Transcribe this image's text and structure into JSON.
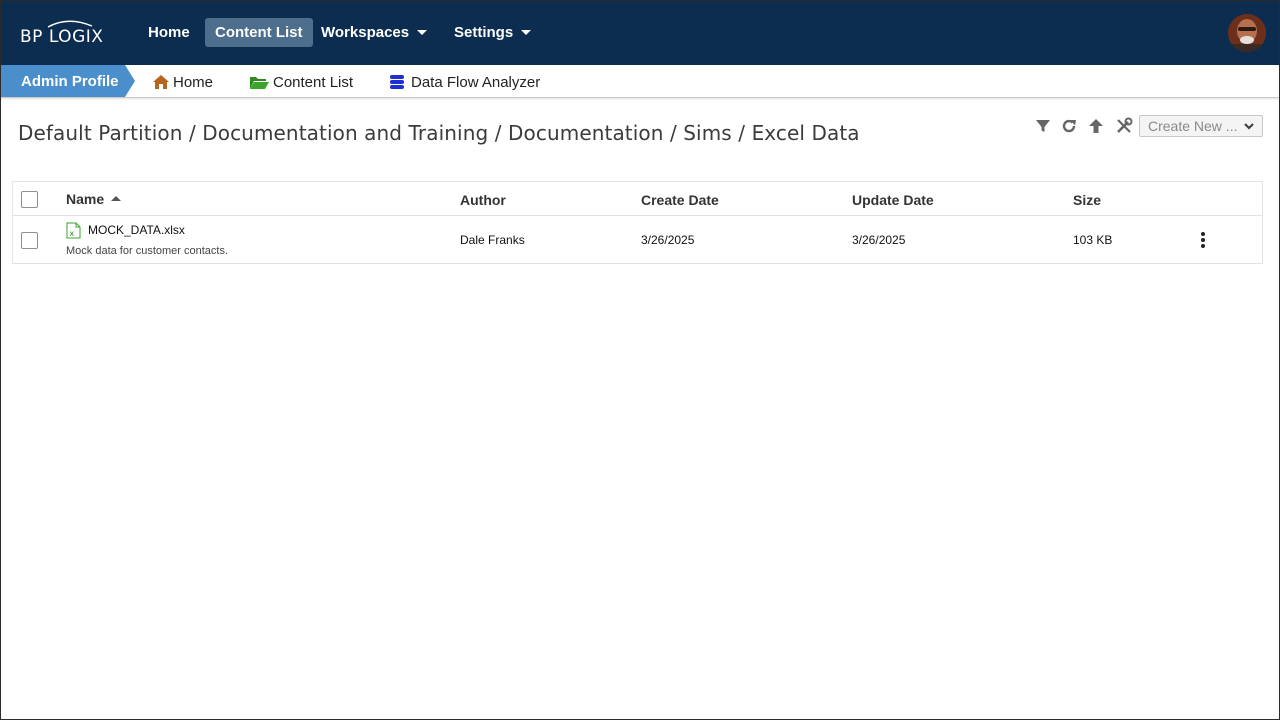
{
  "brand": {
    "logo_text": "BP LOGIX"
  },
  "topnav": {
    "items": [
      {
        "label": "Home"
      },
      {
        "label": "Content List"
      },
      {
        "label": "Workspaces"
      },
      {
        "label": "Settings"
      }
    ],
    "active": "Content List",
    "background": "#0c2d4f",
    "active_background": "#4e6e8d"
  },
  "subbar": {
    "profile_label": "Admin Profile",
    "profile_color": "#4a8fcc",
    "links": [
      {
        "label": "Home",
        "icon": "home-icon",
        "icon_color": "#b5651d"
      },
      {
        "label": "Content List",
        "icon": "folder-open-icon",
        "icon_color": "#2e8b1f"
      },
      {
        "label": "Data Flow Analyzer",
        "icon": "database-icon",
        "icon_color": "#1f2fd6"
      }
    ]
  },
  "breadcrumb": {
    "path": "Default Partition / Documentation and Training / Documentation / Sims / Excel Data"
  },
  "toolbar": {
    "icons": [
      "filter-icon",
      "refresh-icon",
      "up-arrow-icon",
      "tools-icon"
    ],
    "create_new_label": "Create New ..."
  },
  "table": {
    "columns": [
      "Name",
      "Author",
      "Create Date",
      "Update Date",
      "Size"
    ],
    "sort_column": "Name",
    "sort_direction": "ascending",
    "rows": [
      {
        "name": "MOCK_DATA.xlsx",
        "description": "Mock data for customer contacts.",
        "author": "Dale Franks",
        "create_date": "3/26/2025",
        "update_date": "3/26/2025",
        "size": "103 KB",
        "icon": "excel-file-icon"
      }
    ]
  }
}
